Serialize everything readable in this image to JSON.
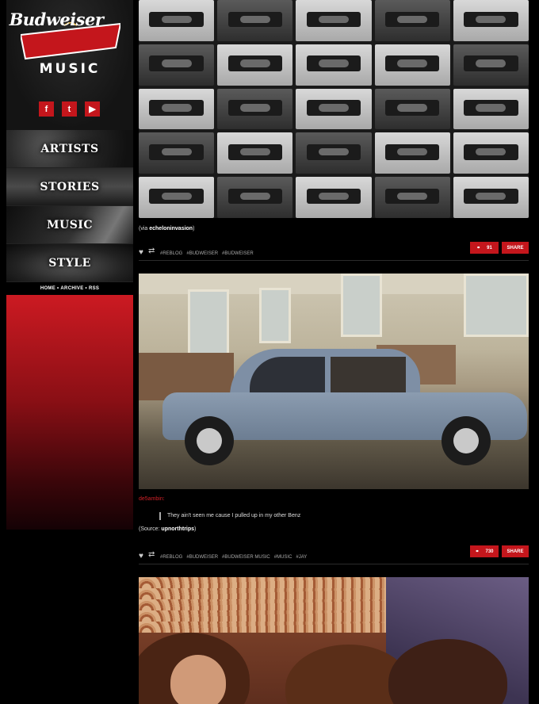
{
  "brand": {
    "logo_text": "Budweiser",
    "section": "MUSIC",
    "red": "#c4161c"
  },
  "social": [
    {
      "icon": "facebook-icon",
      "glyph": "f"
    },
    {
      "icon": "twitter-icon",
      "glyph": "t"
    },
    {
      "icon": "youtube-icon",
      "glyph": "▶"
    }
  ],
  "nav": {
    "artists": "ARTISTS",
    "stories": "STORIES",
    "music": "MUSIC",
    "style": "STYLE"
  },
  "subnav": {
    "home": "HOME",
    "archive": "ARCHIVE",
    "rss": "RSS",
    "sep": "•"
  },
  "posts": [
    {
      "caption_prefix": "(via",
      "caption_link": "echeloninvasion",
      "caption_suffix": ")",
      "tags": [
        "#REBLOG",
        "#BUDWEISER",
        "#BUDWEISER"
      ],
      "notes": "91",
      "share": "SHARE"
    },
    {
      "user": "de5ambin:",
      "quote": "They ain't seen me cause I pulled up in my other Benz",
      "source_prefix": "(Source:",
      "source_link": "upnorthtrips",
      "source_suffix": ")",
      "tags": [
        "#REBLOG",
        "#BUDWEISER",
        "#BUDWEISER MUSIC",
        "#MUSIC",
        "#JAY"
      ],
      "notes": "730",
      "share": "SHARE"
    }
  ]
}
